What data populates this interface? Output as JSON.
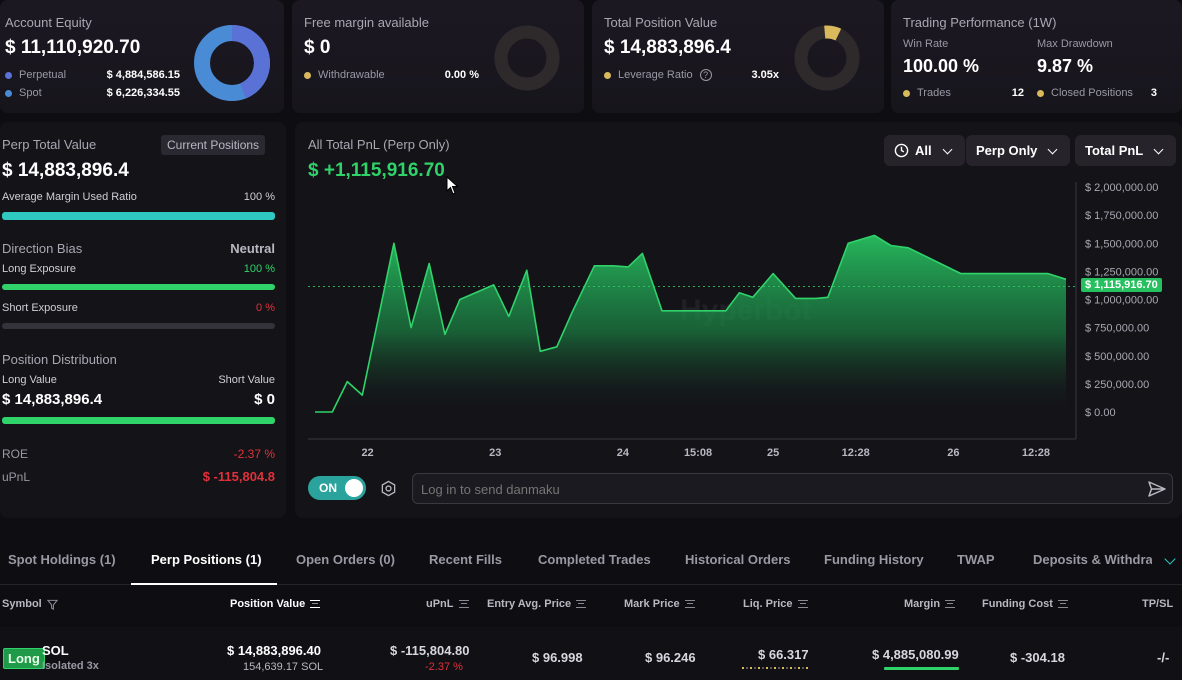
{
  "colors": {
    "accent_green": "#2fd36a",
    "accent_red": "#e0313a",
    "perpetual_blue": "#5a72d6",
    "spot_blue": "#4a8bd6",
    "gold": "#d9b95c",
    "teal": "#2fc9c2"
  },
  "equity": {
    "title": "Account Equity",
    "value": "$ 11,110,920.70",
    "perp_label": "Perpetual",
    "perp_value": "$ 4,884,586.15",
    "spot_label": "Spot",
    "spot_value": "$ 6,226,334.55",
    "perp_share": 0.44
  },
  "free_margin": {
    "title": "Free margin available",
    "value": "$ 0",
    "withdrawable_label": "Withdrawable",
    "withdrawable_value": "0.00 %"
  },
  "position_value": {
    "title": "Total Position Value",
    "value": "$ 14,883,896.4",
    "leverage_label": "Leverage Ratio",
    "leverage_value": "3.05x"
  },
  "performance": {
    "title": "Trading Performance (1W)",
    "win_rate_label": "Win Rate",
    "win_rate_value": "100.00 %",
    "drawdown_label": "Max Drawdown",
    "drawdown_value": "9.87 %",
    "trades_label": "Trades",
    "trades_value": "12",
    "closed_label": "Closed Positions",
    "closed_value": "3"
  },
  "perp_panel": {
    "title": "Perp Total Value",
    "current_positions_btn": "Current Positions",
    "value": "$ 14,883,896.4",
    "avg_margin_label": "Average Margin Used Ratio",
    "avg_margin_value": "100 %",
    "avg_margin_fraction": 1.0,
    "direction_title": "Direction Bias",
    "direction_value": "Neutral",
    "long_exp_label": "Long Exposure",
    "long_exp_value": "100 %",
    "long_exp_fraction": 1.0,
    "short_exp_label": "Short Exposure",
    "short_exp_value": "0 %",
    "short_exp_fraction": 0.0,
    "distribution_title": "Position Distribution",
    "long_value_label": "Long Value",
    "short_value_label": "Short Value",
    "long_value": "$ 14,883,896.4",
    "short_value": "$ 0",
    "long_fraction": 1.0,
    "roe_label": "ROE",
    "roe_value": "-2.37 %",
    "upnl_label": "uPnL",
    "upnl_value": "$ -115,804.8"
  },
  "pnl_chart": {
    "title": "All Total PnL (Perp Only)",
    "value": "$ +1,115,916.70",
    "filter_time": "All",
    "filter_scope": "Perp Only",
    "filter_metric": "Total PnL",
    "watermark": "Hyperbot",
    "current_label": "$ 1,115,916.70",
    "toggle_label": "ON",
    "danmaku_placeholder": "Log in to send danmaku"
  },
  "chart_data": {
    "type": "area",
    "title": "All Total PnL (Perp Only)",
    "ylim": [
      0,
      2000000
    ],
    "yticks": [
      0,
      250000,
      500000,
      750000,
      1000000,
      1250000,
      1500000,
      1750000,
      2000000
    ],
    "ytick_labels": [
      "$ 0.00",
      "$ 250,000.00",
      "$ 500,000.00",
      "$ 750,000.00",
      "$ 1,000,000.00",
      "$ 1,250,000.00",
      "$ 1,500,000.00",
      "$ 1,750,000.00",
      "$ 2,000,000.00"
    ],
    "xtick_labels": [
      "22",
      "23",
      "24",
      "15:08",
      "25",
      "12:28",
      "26",
      "12:28"
    ],
    "xtick_pos": [
      0.07,
      0.24,
      0.41,
      0.51,
      0.61,
      0.72,
      0.85,
      0.96
    ],
    "x": [
      0.0,
      0.023,
      0.043,
      0.063,
      0.105,
      0.128,
      0.152,
      0.173,
      0.193,
      0.238,
      0.258,
      0.282,
      0.3,
      0.322,
      0.342,
      0.372,
      0.397,
      0.417,
      0.436,
      0.462,
      0.478,
      0.52,
      0.547,
      0.565,
      0.583,
      0.61,
      0.64,
      0.667,
      0.683,
      0.71,
      0.745,
      0.767,
      0.79,
      0.86,
      0.94,
      0.976,
      1.0
    ],
    "values": [
      0,
      0,
      270000,
      150000,
      1500000,
      750000,
      1320000,
      690000,
      1000000,
      1130000,
      850000,
      1260000,
      540000,
      580000,
      880000,
      1300000,
      1300000,
      1290000,
      1410000,
      900000,
      900000,
      900000,
      900000,
      1060000,
      1020000,
      1230000,
      1010000,
      1010000,
      1020000,
      1500000,
      1570000,
      1480000,
      1460000,
      1230000,
      1230000,
      1230000,
      1180000,
      1115916.7
    ],
    "current_value": 1115916.7
  },
  "tabs": [
    {
      "label": "Spot Holdings (1)",
      "active": false
    },
    {
      "label": "Perp Positions (1)",
      "active": true
    },
    {
      "label": "Open Orders (0)",
      "active": false
    },
    {
      "label": "Recent Fills",
      "active": false
    },
    {
      "label": "Completed Trades",
      "active": false
    },
    {
      "label": "Historical Orders",
      "active": false
    },
    {
      "label": "Funding History",
      "active": false
    },
    {
      "label": "TWAP",
      "active": false
    },
    {
      "label": "Deposits & Withdraw",
      "active": false
    }
  ],
  "table": {
    "headers": {
      "symbol": "Symbol",
      "position_value": "Position Value",
      "upnl": "uPnL",
      "entry": "Entry Avg. Price",
      "mark": "Mark Price",
      "liq": "Liq. Price",
      "margin": "Margin",
      "funding": "Funding Cost",
      "tpsl": "TP/SL"
    },
    "row": {
      "side": "Long",
      "symbol": "SOL",
      "margin_mode": "Isolated 3x",
      "position_value": "$ 14,883,896.40",
      "position_size": "154,639.17 SOL",
      "upnl": "$ -115,804.80",
      "upnl_pct": "-2.37 %",
      "entry": "$ 96.998",
      "mark": "$ 96.246",
      "liq": "$ 66.317",
      "margin": "$ 4,885,080.99",
      "funding": "$ -304.18",
      "tpsl": "-/-"
    }
  }
}
